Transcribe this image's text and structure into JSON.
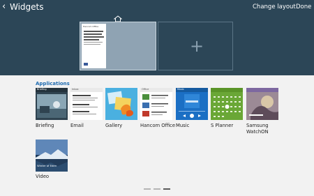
{
  "header": {
    "title": "Widgets",
    "change_layout_label": "Change layout",
    "done_label": "Done"
  },
  "preview_panel": {
    "widget_header": "Hancom Office"
  },
  "section_title": "Applications",
  "apps": [
    {
      "label": "Briefing",
      "tile_header": "Briefing",
      "icon": "briefing-tile"
    },
    {
      "label": "Email",
      "tile_header": "Inbox",
      "icon": "email-tile"
    },
    {
      "label": "Gallery",
      "tile_header": "",
      "icon": "gallery-tile"
    },
    {
      "label": "Hancom Office",
      "tile_header": "Office",
      "icon": "hancom-office-tile"
    },
    {
      "label": "Music",
      "tile_header": "Music",
      "icon": "music-tile"
    },
    {
      "label": "S Planner",
      "tile_header": "",
      "icon": "s-planner-tile"
    },
    {
      "label": "Samsung WatchON",
      "tile_header": "",
      "icon": "samsung-watchon-tile"
    },
    {
      "label": "Video",
      "tile_header": "Winter of Eden",
      "icon": "video-tile"
    }
  ],
  "page_indicator": {
    "count": 3,
    "active": 2
  },
  "colors": {
    "topbar": "#2c4657",
    "accent": "#1e6bb0",
    "background": "#f2f2f2"
  }
}
